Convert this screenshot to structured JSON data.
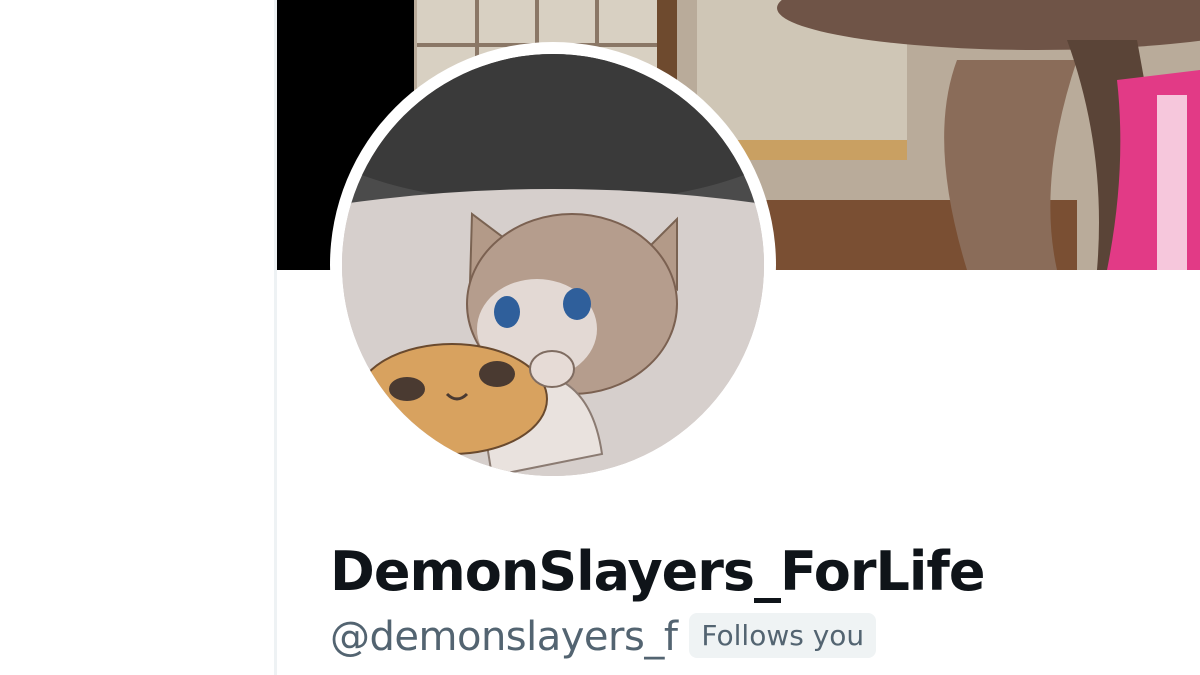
{
  "profile": {
    "display_name": "DemonSlayers_ForLife",
    "handle": "@demonslayers_f",
    "follows_you_badge": "Follows you"
  },
  "colors": {
    "name_text": "#0f1419",
    "secondary_text": "#536471",
    "badge_background": "#eff3f4",
    "avatar_ring": "#ffffff"
  },
  "icons": {
    "avatar": "avatar-drawing-cat-girl",
    "banner": "banner-anime-room"
  }
}
